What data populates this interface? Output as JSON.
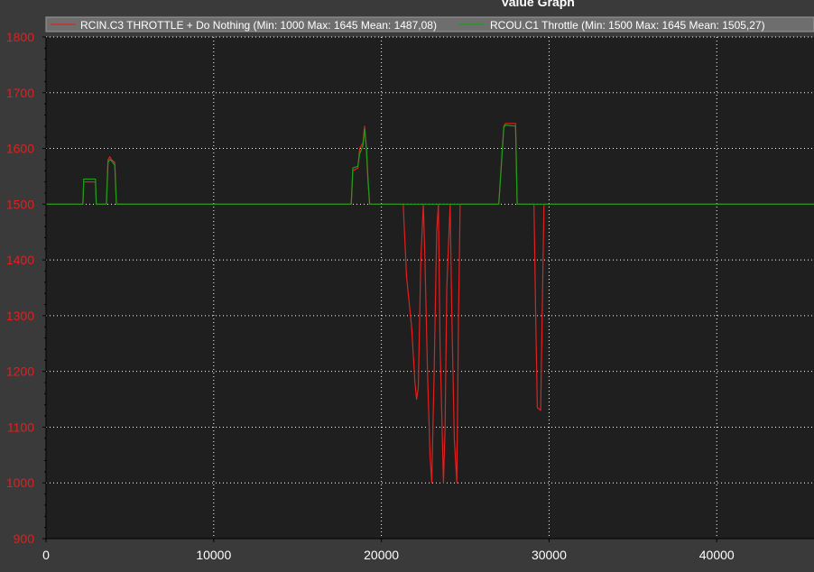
{
  "chart_data": {
    "type": "line",
    "title": "Value Graph",
    "xlabel": "",
    "ylabel": "",
    "xlim": [
      0,
      45800
    ],
    "ylim": [
      900,
      1800
    ],
    "xticks": [
      0,
      10000,
      20000,
      30000,
      40000
    ],
    "yticks": [
      900,
      1000,
      1100,
      1200,
      1300,
      1400,
      1500,
      1600,
      1700,
      1800
    ],
    "grid": true,
    "legend_position": "top",
    "colors": {
      "plot_background": "#1f1f1f",
      "page_background": "#3a3a3a",
      "legend_background": "#6e6e6e",
      "ytick_color": "#e0201f",
      "xtick_color": "#ffffff",
      "grid_color": "#ffffff"
    },
    "series": [
      {
        "name": "RCIN.C3 THROTTLE + Do Nothing (Min: 1000 Max: 1645 Mean: 1487,08)",
        "color": "#e0201f",
        "x": [
          0,
          2200,
          2250,
          2950,
          3000,
          3600,
          3700,
          3800,
          3900,
          4100,
          4200,
          4300,
          18200,
          18300,
          18600,
          18700,
          18900,
          19000,
          19100,
          19200,
          19300,
          21300,
          21500,
          21800,
          22000,
          22100,
          22200,
          22350,
          22500,
          22600,
          22750,
          22900,
          23000,
          23150,
          23300,
          23400,
          23500,
          23700,
          23800,
          23900,
          24100,
          24200,
          24350,
          24500,
          24600,
          24700,
          27000,
          27300,
          27400,
          28000,
          28100,
          29100,
          29200,
          29300,
          29500,
          29700,
          45800
        ],
        "y": [
          1500,
          1500,
          1540,
          1540,
          1500,
          1500,
          1580,
          1585,
          1580,
          1575,
          1500,
          1500,
          1500,
          1560,
          1565,
          1600,
          1610,
          1640,
          1600,
          1540,
          1500,
          1500,
          1370,
          1280,
          1180,
          1150,
          1170,
          1400,
          1500,
          1400,
          1200,
          1050,
          1000,
          1200,
          1450,
          1500,
          1250,
          1000,
          1100,
          1350,
          1500,
          1300,
          1080,
          1000,
          1300,
          1500,
          1500,
          1640,
          1645,
          1645,
          1500,
          1500,
          1300,
          1135,
          1130,
          1500,
          1500
        ]
      },
      {
        "name": "RCOU.C1 Throttle (Min: 1500 Max: 1645 Mean: 1505,27)",
        "color": "#18a018",
        "x": [
          0,
          2200,
          2250,
          2950,
          3000,
          3600,
          3700,
          3800,
          3900,
          4100,
          4200,
          4300,
          18200,
          18300,
          18600,
          18700,
          18900,
          19000,
          19100,
          19200,
          19300,
          27000,
          27300,
          27400,
          28000,
          28100,
          45800
        ],
        "y": [
          1500,
          1500,
          1545,
          1545,
          1500,
          1500,
          1575,
          1580,
          1578,
          1570,
          1500,
          1500,
          1500,
          1565,
          1568,
          1590,
          1605,
          1635,
          1605,
          1545,
          1500,
          1500,
          1638,
          1642,
          1640,
          1500,
          1500
        ]
      }
    ]
  }
}
